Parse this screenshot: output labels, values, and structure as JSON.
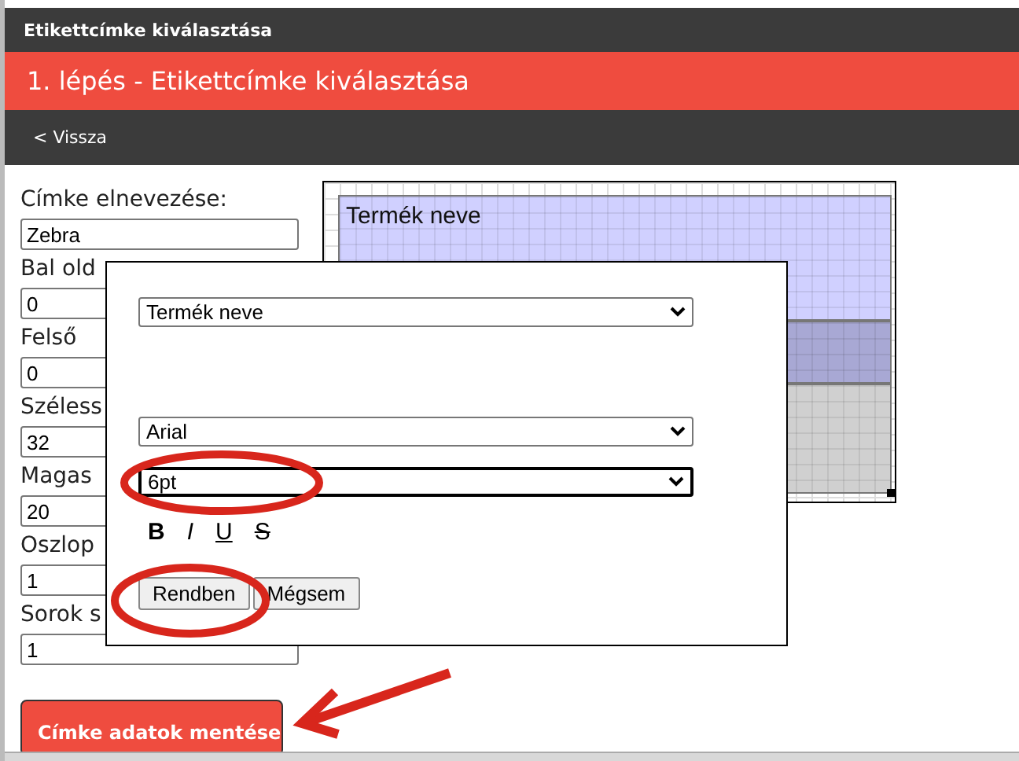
{
  "window": {
    "title": "Etikettcímke kiválasztása"
  },
  "step_title": "1. lépés - Etikettcímke kiválasztása",
  "nav": {
    "back": "< Vissza"
  },
  "form": {
    "fields": [
      {
        "label": "Címke elnevezése:",
        "value": "Zebra"
      },
      {
        "label": "Bal old",
        "value": "0"
      },
      {
        "label": "Felső",
        "value": "0"
      },
      {
        "label": "Széless",
        "value": "32"
      },
      {
        "label": "Magas",
        "value": "20"
      },
      {
        "label": "Oszlop",
        "value": "1"
      },
      {
        "label": "Sorok s",
        "value": "1"
      }
    ]
  },
  "save_button": "Címke adatok mentése",
  "preview": {
    "field_label": "Termék neve"
  },
  "dialog": {
    "field_select": {
      "value": "Termék neve",
      "focused": false
    },
    "font_select": {
      "value": "Arial",
      "focused": false
    },
    "size_select": {
      "value": "6pt",
      "focused": true
    },
    "style_buttons": [
      {
        "kind": "bold",
        "label": "B"
      },
      {
        "kind": "italic",
        "label": "I"
      },
      {
        "kind": "underline",
        "label": "U"
      },
      {
        "kind": "strike",
        "label": "S"
      }
    ],
    "buttons": [
      "Rendben",
      "Mégsem"
    ]
  }
}
